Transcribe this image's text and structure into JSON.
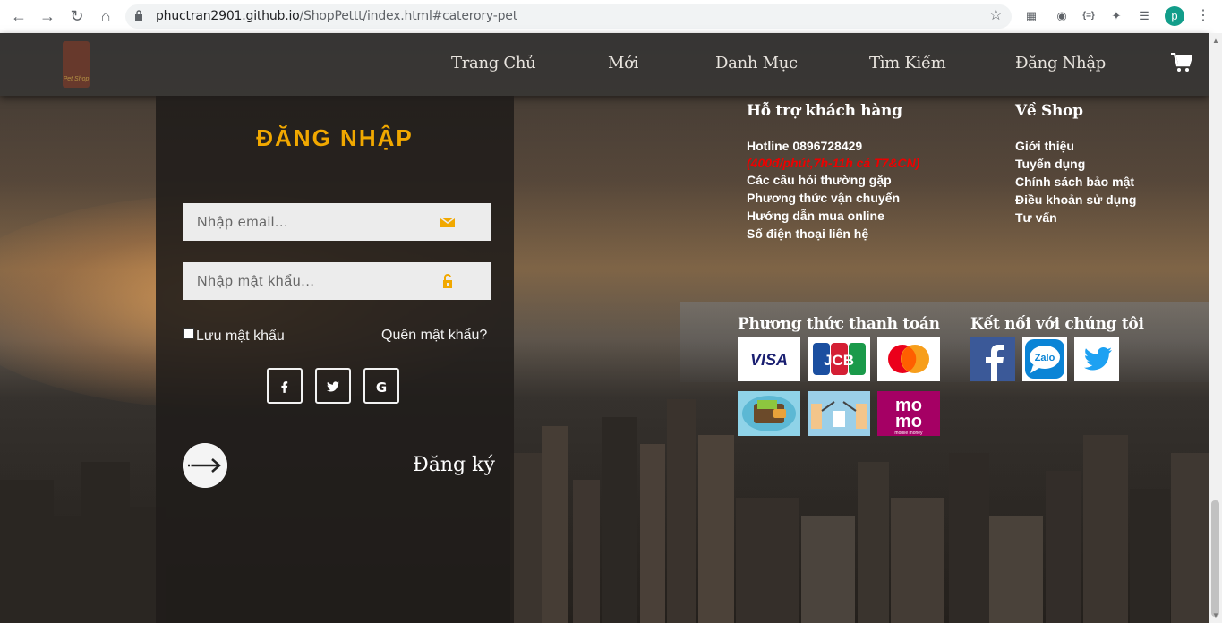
{
  "browser": {
    "url_host": "phuctran2901.github.io",
    "url_path": "/ShopPettt/index.html#caterory-pet",
    "profile_initial": "p"
  },
  "header": {
    "logo_text": "Pet Shop",
    "nav": [
      "Trang Chủ",
      "Mới",
      "Danh Mục",
      "Tìm Kiếm",
      "Đăng Nhập"
    ],
    "cart_icon": "cart-icon"
  },
  "login": {
    "title": "ĐĂNG NHẬP",
    "email_placeholder": "Nhập email...",
    "password_placeholder": "Nhập mật khẩu...",
    "remember_label": "Lưu mật khẩu",
    "forgot_label": "Quên mật khẩu?",
    "social": [
      "f",
      "twitter",
      "G"
    ],
    "register_label": "Đăng ký",
    "accent_color": "#f1a800"
  },
  "support": {
    "title": "Hỗ trợ khách hàng",
    "hotline": "Hotline 0896728429",
    "hotline_note": "(400đ/phút,7h-11h cả T7&CN)",
    "links": [
      "Các câu hỏi thường gặp",
      "Phương thức vận chuyển",
      "Hướng dẫn mua online",
      "Số điện thoại liên hệ"
    ]
  },
  "about": {
    "title": "Về Shop",
    "links": [
      "Giới thiệu",
      "Tuyển dụng",
      "Chính sách bảo mật",
      "Điều khoản sử dụng",
      "Tư vấn"
    ]
  },
  "payment": {
    "title": "Phương thức thanh toán",
    "visa": "VISA",
    "jcb": "JCB",
    "momo_line1": "mo",
    "momo_line2": "mo",
    "momo_caption": "mobile money"
  },
  "connect": {
    "title": "Kết nối với chúng tôi",
    "zalo": "Zalo"
  }
}
